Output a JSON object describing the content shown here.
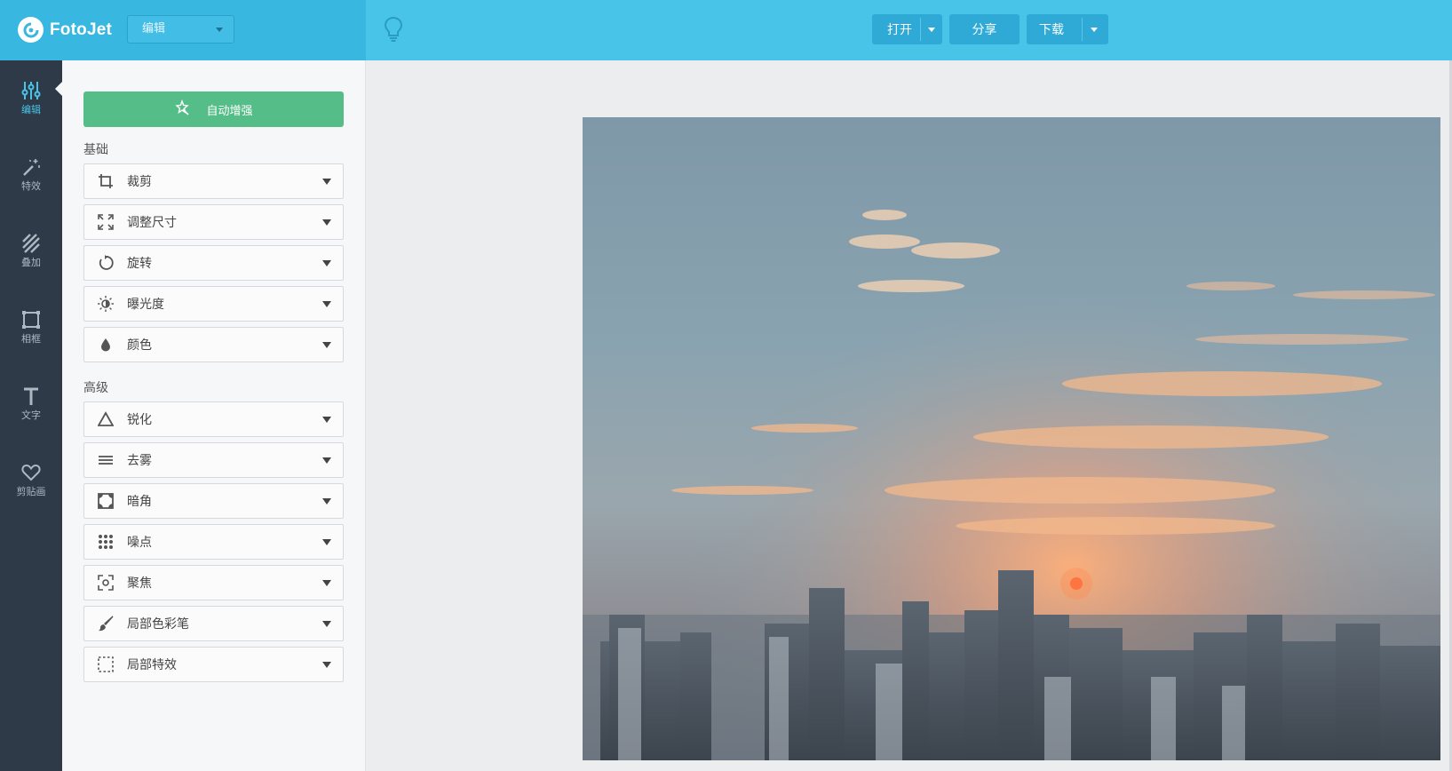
{
  "app": {
    "name": "FotoJet"
  },
  "header": {
    "mode_select": "编辑",
    "buttons": {
      "open": "打开",
      "share": "分享",
      "download": "下载"
    }
  },
  "rail": [
    {
      "label": "编辑",
      "icon": "sliders-icon",
      "active": true
    },
    {
      "label": "特效",
      "icon": "magic-wand-icon"
    },
    {
      "label": "叠加",
      "icon": "overlay-stripes-icon"
    },
    {
      "label": "相框",
      "icon": "frame-icon"
    },
    {
      "label": "文字",
      "icon": "text-icon"
    },
    {
      "label": "剪贴画",
      "icon": "heart-icon"
    }
  ],
  "panel": {
    "auto_enhance": "自动增强",
    "basic_title": "基础",
    "basic": [
      {
        "label": "裁剪",
        "icon": "crop-icon"
      },
      {
        "label": "调整尺寸",
        "icon": "resize-icon"
      },
      {
        "label": "旋转",
        "icon": "rotate-icon"
      },
      {
        "label": "曝光度",
        "icon": "exposure-icon"
      },
      {
        "label": "颜色",
        "icon": "color-drop-icon"
      }
    ],
    "advanced_title": "高级",
    "advanced": [
      {
        "label": "锐化",
        "icon": "sharpen-icon"
      },
      {
        "label": "去雾",
        "icon": "dehaze-icon"
      },
      {
        "label": "暗角",
        "icon": "vignette-icon"
      },
      {
        "label": "噪点",
        "icon": "noise-icon"
      },
      {
        "label": "聚焦",
        "icon": "focus-icon"
      },
      {
        "label": "局部色彩笔",
        "icon": "brush-icon"
      },
      {
        "label": "局部特效",
        "icon": "selection-icon"
      }
    ]
  },
  "colors": {
    "header": "#47c4e8",
    "header_dark": "#38b7e0",
    "rail": "#2e3a48",
    "accent_green": "#55be88",
    "active": "#47c4e8"
  }
}
